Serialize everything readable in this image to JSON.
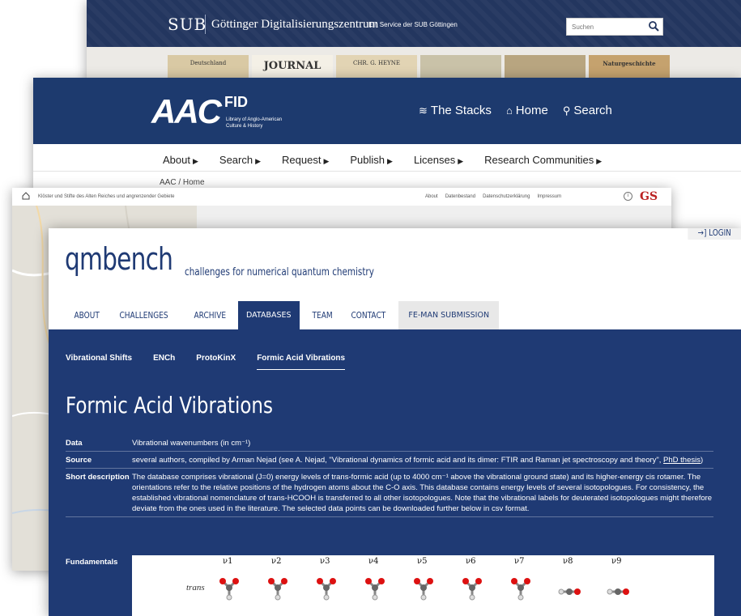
{
  "sub": {
    "logo": "SUB",
    "title": "Göttinger Digitalisierungszentrum",
    "tagline": "Ein Service der SUB Göttingen",
    "search_placeholder": "Suchen",
    "books": [
      "Deutschland",
      "JOURNAL",
      "CHR. G. HEYNE",
      "",
      "",
      "Naturgeschichte"
    ]
  },
  "aac": {
    "brand_big": "AAC",
    "brand_fid": "FID",
    "brand_line1": "Library of Anglo-American",
    "brand_line2": "Culture & History",
    "top_nav": [
      {
        "icon": "layers-icon",
        "label": "The Stacks"
      },
      {
        "icon": "home-icon",
        "label": "Home"
      },
      {
        "icon": "search-icon",
        "label": "Search"
      }
    ],
    "main_nav": [
      "About",
      "Search",
      "Request",
      "Publish",
      "Licenses",
      "Research Communities"
    ],
    "breadcrumb": "AAC / Home"
  },
  "gs": {
    "title": "Klöster und Stifte des Alten Reiches und angrenzender Gebiete",
    "links": [
      "About",
      "Datenbestand",
      "Datenschutzerklärung",
      "Impressum"
    ],
    "logo": "GS"
  },
  "qm": {
    "login": "→] LOGIN",
    "logo": "qmbench",
    "tagline": "challenges for numerical quantum chemistry",
    "nav": [
      "ABOUT",
      "CHALLENGES",
      "ARCHIVE",
      "DATABASES",
      "TEAM",
      "CONTACT",
      "FE-MAN SUBMISSION"
    ],
    "active_nav": "DATABASES",
    "subnav": [
      "Vibrational Shifts",
      "ENCh",
      "ProtoKinX",
      "Formic Acid Vibrations"
    ],
    "page_title": "Formic Acid Vibrations",
    "rows": [
      {
        "key": "Data",
        "value": "Vibrational wavenumbers (in cm⁻¹)"
      },
      {
        "key": "Source",
        "value": "several authors, compiled by Arman Nejad (see A. Nejad, \"Vibrational dynamics of formic acid and its dimer: FTIR and Raman jet spectroscopy and theory\",",
        "link": "PhD thesis",
        "after": ")"
      },
      {
        "key": "Short description",
        "value": "The database comprises vibrational (J=0) energy levels of trans-formic acid (up to 4000 cm⁻¹ above the vibrational ground state) and its higher-energy cis rotamer. The orientations refer to the relative positions of the hydrogen atoms about the C-O axis. This database contains energy levels of several isotopologues. For consistency, the established vibrational nomenclature of trans-HCOOH is transferred to all other isotopologues. Note that the vibrational labels for deuterated isotopologues might therefore deviate from the ones used in the literature. The selected data points can be downloaded further below in csv format."
      }
    ],
    "fundamentals_label": "Fundamentals",
    "modes": [
      "ν1",
      "ν2",
      "ν3",
      "ν4",
      "ν5",
      "ν6",
      "ν7",
      "ν8",
      "ν9"
    ],
    "row_label": "trans"
  }
}
